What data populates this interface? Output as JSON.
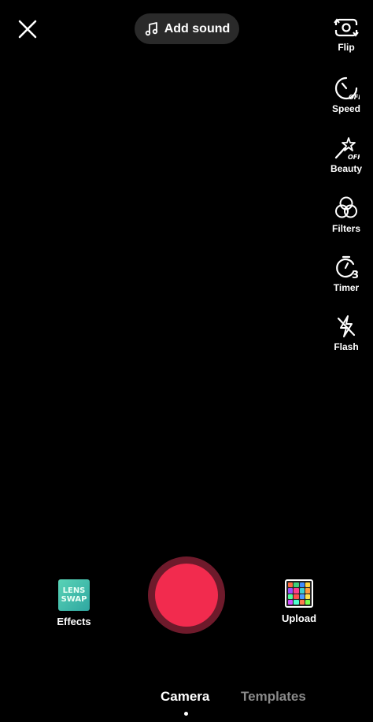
{
  "top": {
    "close_icon": "close-icon",
    "add_sound_label": "Add sound",
    "music_icon": "music-note-icon"
  },
  "tools": [
    {
      "label": "Flip",
      "icon": "flip-camera-icon"
    },
    {
      "label": "Speed",
      "icon": "speed-icon",
      "badge": "OFF"
    },
    {
      "label": "Beauty",
      "icon": "beauty-wand-icon",
      "badge": "OFF"
    },
    {
      "label": "Filters",
      "icon": "filters-icon"
    },
    {
      "label": "Timer",
      "icon": "timer-icon",
      "badge": "3"
    },
    {
      "label": "Flash",
      "icon": "flash-off-icon"
    }
  ],
  "bottom": {
    "effects_label": "Effects",
    "effects_thumb_text": [
      "LENS",
      "SWAP"
    ],
    "upload_label": "Upload",
    "record_color": "#f22b4e"
  },
  "modes": {
    "active": "Camera",
    "inactive": "Templates"
  }
}
